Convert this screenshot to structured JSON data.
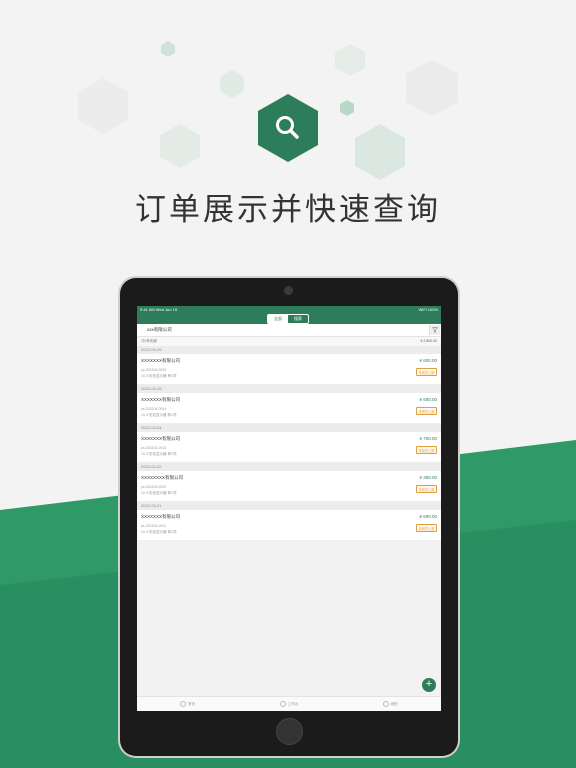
{
  "headline": "订单展示并快速查询",
  "colors": {
    "brand": "#2e7d5a",
    "badge": "#e0a040"
  },
  "icons": {
    "hero": "search-icon",
    "fab": "plus-icon",
    "filter": "filter-icon"
  },
  "status": {
    "time": "9:41 AM   Wed Jun 15",
    "right": "WiFi 100%"
  },
  "segments": [
    "全部",
    "搜索"
  ],
  "search": {
    "value": "xxx有限公司"
  },
  "summary": {
    "left": "共5条明细",
    "right": "¥ 2,850.00"
  },
  "groups": [
    {
      "date": "2022-04-26",
      "order": {
        "company": "XXXXXXX有限公司",
        "amount": "¥ 600.00",
        "code": "yx-202204-0015",
        "product": "10.4\"彩色显示器 等1项",
        "badge": "未到货上报"
      }
    },
    {
      "date": "2022-04-26",
      "order": {
        "company": "XXXXXXX有限公司",
        "amount": "¥ 600.00",
        "code": "yx-202204-0014",
        "product": "10.4\"彩色显示器 等1项",
        "badge": "未到货上报"
      }
    },
    {
      "date": "2022-04-24",
      "order": {
        "company": "XXXXXXX有限公司",
        "amount": "¥ 700.00",
        "code": "yx-202204-0013",
        "product": "10.4\"彩色显示器 等1项",
        "badge": "未到货上报"
      }
    },
    {
      "date": "2022-04-22",
      "order": {
        "company": "XXXXXXXX有限公司",
        "amount": "¥ 350.00",
        "code": "yx-202204-0012",
        "product": "10.4\"彩色显示器 等1项",
        "badge": "未到货上报"
      }
    },
    {
      "date": "2022-04-21",
      "order": {
        "company": "XXXXXXX有限公司",
        "amount": "¥ 600.00",
        "code": "yx-202204-0011",
        "product": "10.4\"彩色显示器 等1项",
        "badge": "未到货上报"
      }
    }
  ],
  "tabs": [
    "首页",
    "工作台",
    "我的"
  ]
}
